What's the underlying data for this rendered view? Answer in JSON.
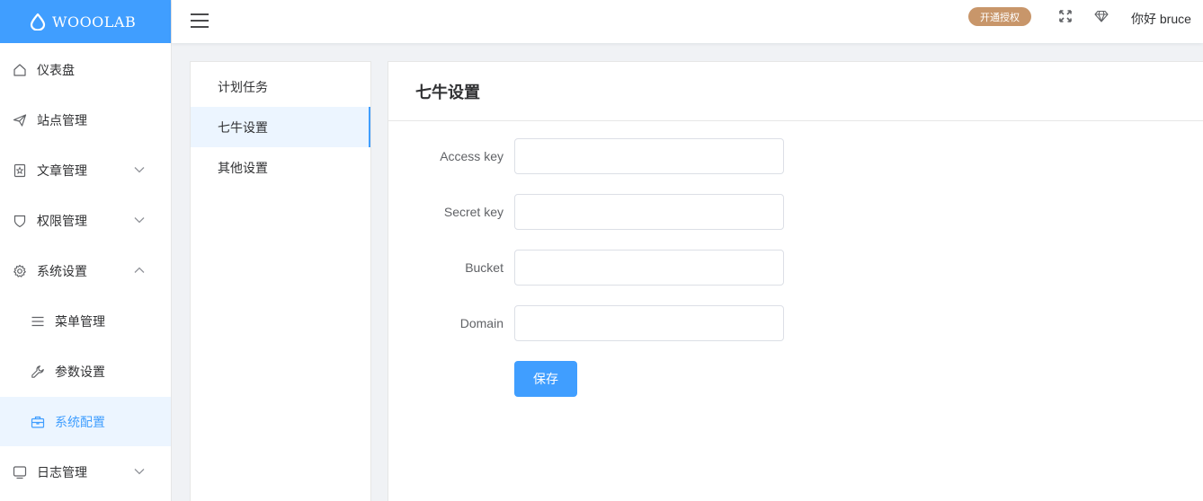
{
  "brand": {
    "name": "WOOOLAB",
    "color": "#409eff"
  },
  "sidebar": {
    "items": [
      {
        "label": "仪表盘",
        "icon": "home-icon"
      },
      {
        "label": "站点管理",
        "icon": "send-icon"
      },
      {
        "label": "文章管理",
        "icon": "document-icon",
        "expandable": true
      },
      {
        "label": "权限管理",
        "icon": "shield-icon",
        "expandable": true
      },
      {
        "label": "系统设置",
        "icon": "gear-icon",
        "expanded": true
      },
      {
        "label": "菜单管理",
        "icon": "list-icon"
      },
      {
        "label": "参数设置",
        "icon": "wrench-icon"
      },
      {
        "label": "系统配置",
        "icon": "briefcase-icon",
        "active": true
      },
      {
        "label": "日志管理",
        "icon": "monitor-icon",
        "expandable": true
      }
    ]
  },
  "header": {
    "badge": "开通授权",
    "badge_color": "#c8966a",
    "greeting": "你好 bruce"
  },
  "subnav": {
    "items": [
      {
        "label": "计划任务"
      },
      {
        "label": "七牛设置",
        "active": true
      },
      {
        "label": "其他设置"
      }
    ]
  },
  "main": {
    "title": "七牛设置",
    "fields": [
      {
        "label": "Access key",
        "value": ""
      },
      {
        "label": "Secret key",
        "value": ""
      },
      {
        "label": "Bucket",
        "value": ""
      },
      {
        "label": "Domain",
        "value": ""
      }
    ],
    "save_label": "保存"
  }
}
